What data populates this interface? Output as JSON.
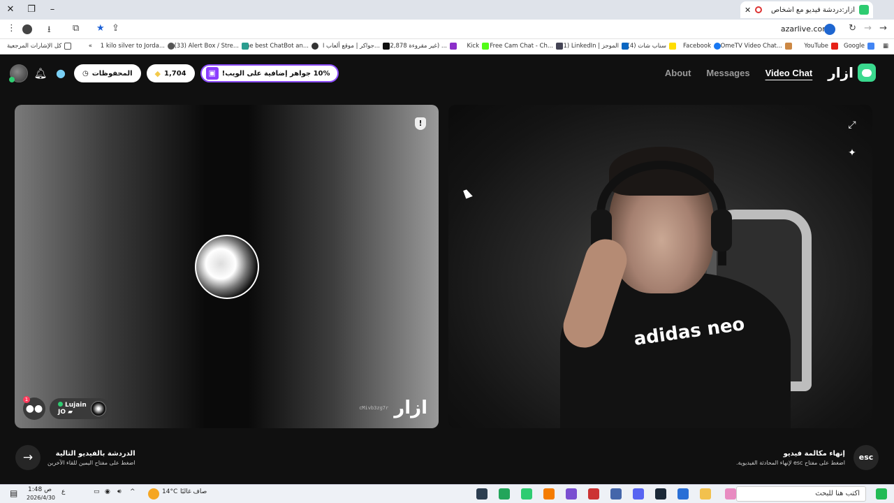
{
  "browser": {
    "tab_title": "أزار:دردشة فيديو مع أشخاص",
    "url": "azarlive.com"
  },
  "bookmarks": [
    {
      "label": "Google",
      "color": "#4285f4"
    },
    {
      "label": "YouTube",
      "color": "#e62117"
    },
    {
      "label": "OmeTV Video Chat...",
      "color": "#c84"
    },
    {
      "label": "Facebook",
      "color": "#1877f2"
    },
    {
      "label": "(4) سناب شات",
      "color": "#ffdd00"
    },
    {
      "label": "(1) LinkedIn | الموجز",
      "color": "#0a66c2"
    },
    {
      "label": "Free Cam Chat - Ch...",
      "color": "#445"
    },
    {
      "label": "Kick",
      "color": "#53fc18"
    },
    {
      "label": "(22,878 غير مقروءة) ...",
      "color": "#8b2fc9"
    },
    {
      "label": "جواكر | موقع ألعاب ا...",
      "color": "#111"
    },
    {
      "label": "The best ChatBot an...",
      "color": "#333"
    },
    {
      "label": "(33) Alert Box / Stre...",
      "color": "#2a9d8f"
    },
    {
      "label": "1 kilo silver to Jorda...",
      "color": "#555"
    },
    {
      "label": "كل الإشارات المرجعية",
      "color": "#555"
    }
  ],
  "nav": {
    "about": "About",
    "messages": "Messages",
    "video_chat": "Video Chat",
    "brand": "ازار",
    "saved": "المحفوظات",
    "gems": "1,704",
    "gift_offer": "10% جواهر إضافية على الويب!"
  },
  "left_panel": {
    "partner_name": "Lujain",
    "partner_country": "JO",
    "watermark": "ازار",
    "watermark_code": "cMivb3zg7r",
    "chat_badge": "1"
  },
  "bottom": {
    "next_title": "الدردشة بالفيديو التالية",
    "next_sub": "اضغط على مفتاح اليمين للقاء الآخرين",
    "end_title": "إنهاء مكالمة فيديو",
    "end_sub": "اضغط على مفتاح esc لإنهاء المحادثة الفيديوية.",
    "esc_label": "esc"
  },
  "shirt_text": "adidas neo",
  "taskbar": {
    "search_placeholder": "اكتب هنا للبحث",
    "weather_temp": "14°C",
    "weather_desc": "صاف غالبًا",
    "time": "1:48 ص",
    "date": "2026/4/30",
    "lang": "ع"
  },
  "colors": {
    "accent": "#3ad98e",
    "gift_border": "#8c4dff",
    "online": "#2ecc71"
  }
}
